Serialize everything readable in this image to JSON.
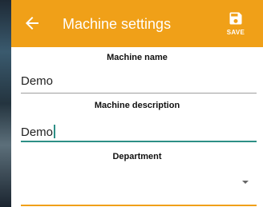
{
  "appbar": {
    "title": "Machine settings",
    "back_icon": "arrow-left-icon",
    "save_label": "SAVE",
    "save_icon": "floppy-disk-icon",
    "color": "#f0a018"
  },
  "form": {
    "machine_name": {
      "label": "Machine name",
      "value": "Demo"
    },
    "machine_description": {
      "label": "Machine description",
      "value": "Demo"
    },
    "department": {
      "label": "Department",
      "value": "",
      "icon": "dropdown-arrow-icon"
    }
  },
  "colors": {
    "focus": "#2d8f86",
    "accent": "#f0a018"
  }
}
